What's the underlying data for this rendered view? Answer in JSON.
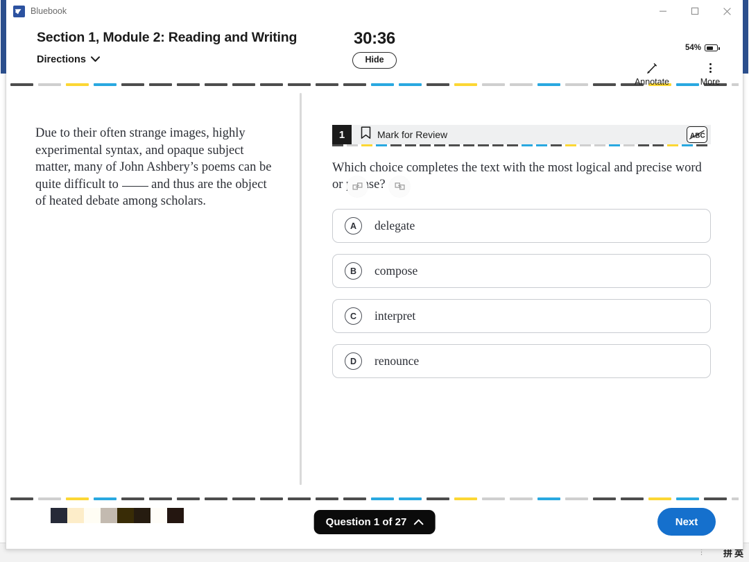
{
  "window": {
    "app_title": "Bluebook",
    "app_logo_icon": "bluebook-logo-icon",
    "controls": [
      {
        "name": "minimize-button",
        "icon": "minimize-icon"
      },
      {
        "name": "maximize-button",
        "icon": "maximize-icon"
      },
      {
        "name": "close-button",
        "icon": "close-icon"
      }
    ]
  },
  "header": {
    "section_title": "Section 1, Module 2: Reading and Writing",
    "directions_label": "Directions",
    "directions_icon": "chevron-down-icon",
    "timer": "30:36",
    "hide_label": "Hide",
    "battery_percent": "54%",
    "battery_icon": "battery-icon",
    "battery_level": 54,
    "tools": [
      {
        "label": "Annotate",
        "icon": "pencil-icon"
      },
      {
        "label": "More",
        "icon": "kebab-menu-icon"
      }
    ]
  },
  "panes": {
    "collapse_left_icon": "expand-panel-icon",
    "collapse_right_icon": "collapse-panel-icon"
  },
  "passage": {
    "before_blank": "Due to their often strange images, highly experimental syntax, and opaque subject matter, many of John Ashbery’s poems can be quite difficult to ",
    "after_blank": " and thus are the object of heated debate among scholars."
  },
  "question": {
    "number": "1",
    "mark_for_review_label": "Mark for Review",
    "bookmark_icon": "bookmark-icon",
    "abc_strikeout_icon": "abc-strikethrough-icon",
    "stem": "Which choice completes the text with the most logical and precise word or phrase?",
    "choices": [
      {
        "letter": "A",
        "text": "delegate"
      },
      {
        "letter": "B",
        "text": "compose"
      },
      {
        "letter": "C",
        "text": "interpret"
      },
      {
        "letter": "D",
        "text": "renounce"
      }
    ]
  },
  "footer": {
    "question_nav_label": "Question 1 of 27",
    "question_nav_icon": "chevron-up-icon",
    "next_label": "Next",
    "swatches": [
      "#262a38",
      "#fdedc9",
      "#fffdf4",
      "#c3bab0",
      "#392c06",
      "#261c10",
      "#fffdf8",
      "#241610"
    ]
  },
  "colors": {
    "accent_blue": "#1570cd",
    "title_accent": "#2b4e8c",
    "dash_dark": "#4d4d4d",
    "dash_yellow": "#fcd734",
    "dash_blue": "#29a8e0",
    "dash_gray": "#cfcfcf"
  },
  "dash_rule_pattern": [
    "dark",
    "gray",
    "yellow",
    "blue",
    "dark",
    "dark",
    "dark",
    "dark",
    "dark",
    "dark",
    "dark",
    "dark",
    "dark",
    "blue",
    "blue",
    "dark",
    "yellow",
    "gray",
    "gray",
    "blue",
    "gray",
    "dark",
    "dark",
    "yellow",
    "blue",
    "dark",
    "gray",
    "dark",
    "yellow",
    "dark",
    "blue",
    "gray",
    "dark",
    "dark",
    "yellow",
    "blue",
    "gray",
    "dark",
    "blue",
    "yellow",
    "dark",
    "gray",
    "dark",
    "blue",
    "dark",
    "yellow",
    "gray",
    "dark",
    "dark",
    "blue",
    "gray",
    "yellow",
    "dark",
    "blue",
    "dark",
    "gray",
    "dark",
    "yellow",
    "blue",
    "dark"
  ],
  "taskbar": {
    "ime_pinyin": "拼",
    "ime_english": "英",
    "dots_icon": "more-dots-icon"
  }
}
